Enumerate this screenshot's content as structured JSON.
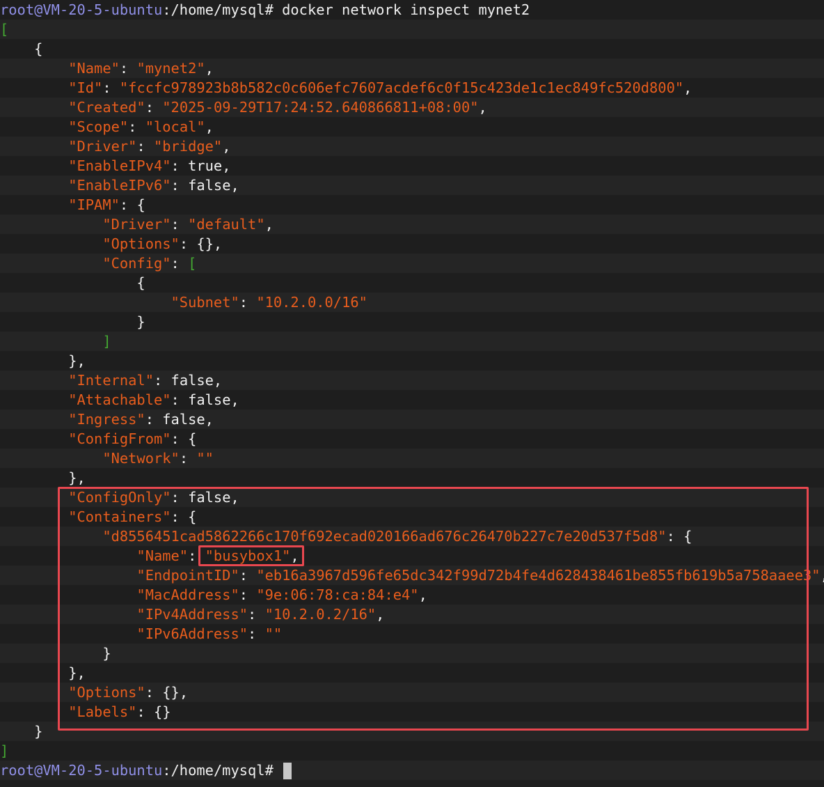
{
  "prompt": {
    "user_host": "root@VM-20-5-ubuntu",
    "path": ":/home/mysql",
    "symbol": "#"
  },
  "command": "docker network inspect mynet2",
  "colors": {
    "background": "#1e1e1e",
    "prompt_user": "#8f8fe6",
    "json_string": "#e85d1d",
    "array_bracket": "#44a832",
    "plain_text": "#f0f0f0",
    "highlight_box": "#e8474f"
  },
  "highlights": [
    "Containers block",
    "busybox1 name value"
  ],
  "lines": [
    [
      [
        "u",
        "root@VM-20-5-ubuntu"
      ],
      [
        "w",
        ":/home/mysql# docker network inspect mynet2"
      ]
    ],
    [
      [
        "b",
        "["
      ]
    ],
    [
      [
        "w",
        "    {"
      ]
    ],
    [
      [
        "w",
        "        "
      ],
      [
        "k",
        "\"Name\""
      ],
      [
        "w",
        ": "
      ],
      [
        "s",
        "\"mynet2\""
      ],
      [
        "w",
        ","
      ]
    ],
    [
      [
        "w",
        "        "
      ],
      [
        "k",
        "\"Id\""
      ],
      [
        "w",
        ": "
      ],
      [
        "s",
        "\"fccfc978923b8b582c0c606efc7607acdef6c0f15c423de1c1ec849fc520d800\""
      ],
      [
        "w",
        ","
      ]
    ],
    [
      [
        "w",
        "        "
      ],
      [
        "k",
        "\"Created\""
      ],
      [
        "w",
        ": "
      ],
      [
        "s",
        "\"2025-09-29T17:24:52.640866811+08:00\""
      ],
      [
        "w",
        ","
      ]
    ],
    [
      [
        "w",
        "        "
      ],
      [
        "k",
        "\"Scope\""
      ],
      [
        "w",
        ": "
      ],
      [
        "s",
        "\"local\""
      ],
      [
        "w",
        ","
      ]
    ],
    [
      [
        "w",
        "        "
      ],
      [
        "k",
        "\"Driver\""
      ],
      [
        "w",
        ": "
      ],
      [
        "s",
        "\"bridge\""
      ],
      [
        "w",
        ","
      ]
    ],
    [
      [
        "w",
        "        "
      ],
      [
        "k",
        "\"EnableIPv4\""
      ],
      [
        "w",
        ": true,"
      ]
    ],
    [
      [
        "w",
        "        "
      ],
      [
        "k",
        "\"EnableIPv6\""
      ],
      [
        "w",
        ": false,"
      ]
    ],
    [
      [
        "w",
        "        "
      ],
      [
        "k",
        "\"IPAM\""
      ],
      [
        "w",
        ": {"
      ]
    ],
    [
      [
        "w",
        "            "
      ],
      [
        "k",
        "\"Driver\""
      ],
      [
        "w",
        ": "
      ],
      [
        "s",
        "\"default\""
      ],
      [
        "w",
        ","
      ]
    ],
    [
      [
        "w",
        "            "
      ],
      [
        "k",
        "\"Options\""
      ],
      [
        "w",
        ": {},"
      ]
    ],
    [
      [
        "w",
        "            "
      ],
      [
        "k",
        "\"Config\""
      ],
      [
        "w",
        ": "
      ],
      [
        "b",
        "["
      ]
    ],
    [
      [
        "w",
        "                {"
      ]
    ],
    [
      [
        "w",
        "                    "
      ],
      [
        "k",
        "\"Subnet\""
      ],
      [
        "w",
        ": "
      ],
      [
        "s",
        "\"10.2.0.0/16\""
      ]
    ],
    [
      [
        "w",
        "                }"
      ]
    ],
    [
      [
        "w",
        "            "
      ],
      [
        "b",
        "]"
      ]
    ],
    [
      [
        "w",
        "        },"
      ]
    ],
    [
      [
        "w",
        "        "
      ],
      [
        "k",
        "\"Internal\""
      ],
      [
        "w",
        ": false,"
      ]
    ],
    [
      [
        "w",
        "        "
      ],
      [
        "k",
        "\"Attachable\""
      ],
      [
        "w",
        ": false,"
      ]
    ],
    [
      [
        "w",
        "        "
      ],
      [
        "k",
        "\"Ingress\""
      ],
      [
        "w",
        ": false,"
      ]
    ],
    [
      [
        "w",
        "        "
      ],
      [
        "k",
        "\"ConfigFrom\""
      ],
      [
        "w",
        ": {"
      ]
    ],
    [
      [
        "w",
        "            "
      ],
      [
        "k",
        "\"Network\""
      ],
      [
        "w",
        ": "
      ],
      [
        "s",
        "\"\""
      ]
    ],
    [
      [
        "w",
        "        },"
      ]
    ],
    [
      [
        "w",
        "        "
      ],
      [
        "k",
        "\"ConfigOnly\""
      ],
      [
        "w",
        ": false,"
      ]
    ],
    [
      [
        "w",
        "        "
      ],
      [
        "k",
        "\"Containers\""
      ],
      [
        "w",
        ": {"
      ]
    ],
    [
      [
        "w",
        "            "
      ],
      [
        "s",
        "\"d8556451cad5862266c170f692ecad020166ad676c26470b227c7e20d537f5d8\""
      ],
      [
        "w",
        ": {"
      ]
    ],
    [
      [
        "w",
        "                "
      ],
      [
        "k",
        "\"Name\""
      ],
      [
        "w",
        ": "
      ],
      [
        "s",
        "\"busybox1\""
      ],
      [
        "w",
        ","
      ]
    ],
    [
      [
        "w",
        "                "
      ],
      [
        "k",
        "\"EndpointID\""
      ],
      [
        "w",
        ": "
      ],
      [
        "s",
        "\"eb16a3967d596fe65dc342f99d72b4fe4d628438461be855fb619b5a758aaee3\""
      ],
      [
        "w",
        ","
      ]
    ],
    [
      [
        "w",
        "                "
      ],
      [
        "k",
        "\"MacAddress\""
      ],
      [
        "w",
        ": "
      ],
      [
        "s",
        "\"9e:06:78:ca:84:e4\""
      ],
      [
        "w",
        ","
      ]
    ],
    [
      [
        "w",
        "                "
      ],
      [
        "k",
        "\"IPv4Address\""
      ],
      [
        "w",
        ": "
      ],
      [
        "s",
        "\"10.2.0.2/16\""
      ],
      [
        "w",
        ","
      ]
    ],
    [
      [
        "w",
        "                "
      ],
      [
        "k",
        "\"IPv6Address\""
      ],
      [
        "w",
        ": "
      ],
      [
        "s",
        "\"\""
      ]
    ],
    [
      [
        "w",
        "            }"
      ]
    ],
    [
      [
        "w",
        "        },"
      ]
    ],
    [
      [
        "w",
        "        "
      ],
      [
        "k",
        "\"Options\""
      ],
      [
        "w",
        ": {},"
      ]
    ],
    [
      [
        "w",
        "        "
      ],
      [
        "k",
        "\"Labels\""
      ],
      [
        "w",
        ": {}"
      ]
    ],
    [
      [
        "w",
        "    }"
      ]
    ],
    [
      [
        "b",
        "]"
      ]
    ],
    [
      [
        "u",
        "root@VM-20-5-ubuntu"
      ],
      [
        "w",
        ":/home/mysql# "
      ],
      [
        "c",
        ""
      ]
    ]
  ]
}
